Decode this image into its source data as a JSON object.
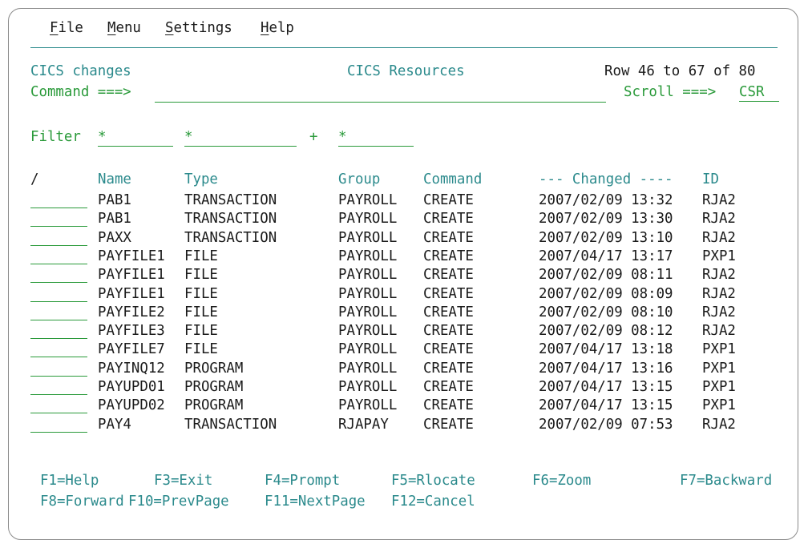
{
  "menu": {
    "file": {
      "mnemonic": "F",
      "rest": "ile"
    },
    "menu": {
      "mnemonic": "M",
      "rest": "enu"
    },
    "settings": {
      "mnemonic": "S",
      "rest": "ettings"
    },
    "help": {
      "mnemonic": "H",
      "rest": "elp"
    }
  },
  "header": {
    "left_title": "CICS changes",
    "center_title": "CICS Resources",
    "row_info": "Row 46 to 67 of 80",
    "command_label": "Command ===>",
    "command_value": "",
    "scroll_label": "Scroll ===>",
    "scroll_value": "CSR"
  },
  "filter": {
    "label": "Filter",
    "name": "*",
    "type": "*",
    "plus": "+",
    "group": "*"
  },
  "columns": {
    "sel": "/",
    "name": "Name",
    "type": "Type",
    "group": "Group",
    "command": "Command",
    "changed": "--- Changed ----",
    "id": "ID"
  },
  "rows": [
    {
      "name": "PAB1",
      "type": "TRANSACTION",
      "group": "PAYROLL",
      "command": "CREATE",
      "changed": "2007/02/09 13:32",
      "id": "RJA2"
    },
    {
      "name": "PAB1",
      "type": "TRANSACTION",
      "group": "PAYROLL",
      "command": "CREATE",
      "changed": "2007/02/09 13:30",
      "id": "RJA2"
    },
    {
      "name": "PAXX",
      "type": "TRANSACTION",
      "group": "PAYROLL",
      "command": "CREATE",
      "changed": "2007/02/09 13:10",
      "id": "RJA2"
    },
    {
      "name": "PAYFILE1",
      "type": "FILE",
      "group": "PAYROLL",
      "command": "CREATE",
      "changed": "2007/04/17 13:17",
      "id": "PXP1"
    },
    {
      "name": "PAYFILE1",
      "type": "FILE",
      "group": "PAYROLL",
      "command": "CREATE",
      "changed": "2007/02/09 08:11",
      "id": "RJA2"
    },
    {
      "name": "PAYFILE1",
      "type": "FILE",
      "group": "PAYROLL",
      "command": "CREATE",
      "changed": "2007/02/09 08:09",
      "id": "RJA2"
    },
    {
      "name": "PAYFILE2",
      "type": "FILE",
      "group": "PAYROLL",
      "command": "CREATE",
      "changed": "2007/02/09 08:10",
      "id": "RJA2"
    },
    {
      "name": "PAYFILE3",
      "type": "FILE",
      "group": "PAYROLL",
      "command": "CREATE",
      "changed": "2007/02/09 08:12",
      "id": "RJA2"
    },
    {
      "name": "PAYFILE7",
      "type": "FILE",
      "group": "PAYROLL",
      "command": "CREATE",
      "changed": "2007/04/17 13:18",
      "id": "PXP1"
    },
    {
      "name": "PAYINQ12",
      "type": "PROGRAM",
      "group": "PAYROLL",
      "command": "CREATE",
      "changed": "2007/04/17 13:16",
      "id": "PXP1"
    },
    {
      "name": "PAYUPD01",
      "type": "PROGRAM",
      "group": "PAYROLL",
      "command": "CREATE",
      "changed": "2007/04/17 13:15",
      "id": "PXP1"
    },
    {
      "name": "PAYUPD02",
      "type": "PROGRAM",
      "group": "PAYROLL",
      "command": "CREATE",
      "changed": "2007/04/17 13:15",
      "id": "PXP1"
    },
    {
      "name": "PAY4",
      "type": "TRANSACTION",
      "group": "RJAPAY",
      "command": "CREATE",
      "changed": "2007/02/09 07:53",
      "id": "RJA2"
    }
  ],
  "fkeys": [
    {
      "label": "F1=Help"
    },
    {
      "label": "F3=Exit"
    },
    {
      "label": "F4=Prompt"
    },
    {
      "label": "F5=Rlocate"
    },
    {
      "label": "F6=Zoom"
    },
    {
      "label": "F7=Backward"
    },
    {
      "label": "F8=Forward"
    },
    {
      "label": "F10=PrevPage"
    },
    {
      "label": "F11=NextPage"
    },
    {
      "label": "F12=Cancel"
    }
  ],
  "colors": {
    "teal": "#2b8a8c",
    "green": "#2a9a3a",
    "text": "#1a1a1a",
    "border": "#8a8a8a"
  }
}
